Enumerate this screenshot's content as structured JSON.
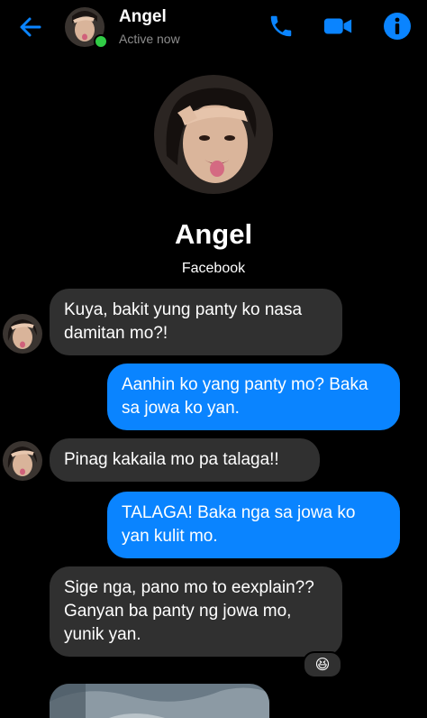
{
  "header": {
    "contact_name": "Angel",
    "status": "Active now",
    "icons": [
      "back-arrow-icon",
      "phone-icon",
      "video-camera-icon",
      "info-icon"
    ],
    "accent_color": "#0a84ff",
    "online_color": "#31cc46"
  },
  "profile": {
    "name": "Angel",
    "subtitle": "Facebook"
  },
  "messages": [
    {
      "side": "incoming",
      "text": "Kuya, bakit yung panty ko nasa damitan mo?!"
    },
    {
      "side": "outgoing",
      "text": "Aanhin ko yang panty mo? Baka sa jowa ko yan."
    },
    {
      "side": "incoming",
      "text": "Pinag kakaila mo pa talaga!!"
    },
    {
      "side": "outgoing",
      "text": "TALAGA! Baka nga sa jowa ko yan kulit mo."
    },
    {
      "side": "incoming",
      "text": "Sige nga, pano mo to eexplain?? Ganyan ba panty ng jowa mo, yunik yan.",
      "reaction": "😆"
    },
    {
      "side": "incoming",
      "type": "photo"
    }
  ],
  "colors": {
    "incoming_bubble": "#303030",
    "outgoing_bubble": "#0a84ff",
    "background": "#000000"
  }
}
